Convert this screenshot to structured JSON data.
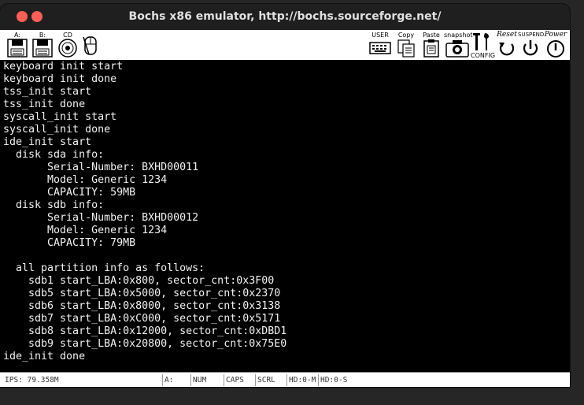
{
  "window": {
    "title": "Bochs x86 emulator, http://bochs.sourceforge.net/"
  },
  "toolbar": {
    "floppy_a": "A:",
    "floppy_b": "B:",
    "cdrom": "CD",
    "user": "USER",
    "copy": "Copy",
    "paste": "Paste",
    "snapshot": "snapshot",
    "config": "CONFIG",
    "reset": "Reset",
    "suspend": "SUSPEND",
    "power": "Power"
  },
  "console": {
    "lines": [
      "keyboard init start",
      "keyboard init done",
      "tss_init start",
      "tss_init done",
      "syscall_init start",
      "syscall_init done",
      "ide_init start",
      "  disk sda info:",
      "       Serial-Number: BXHD00011",
      "       Model: Generic 1234",
      "       CAPACITY: 59MB",
      "  disk sdb info:",
      "       Serial-Number: BXHD00012",
      "       Model: Generic 1234",
      "       CAPACITY: 79MB",
      "",
      "  all partition info as follows:",
      "    sdb1 start_LBA:0x800, sector_cnt:0x3F00",
      "    sdb5 start_LBA:0x5000, sector_cnt:0x2370",
      "    sdb6 start_LBA:0x8000, sector_cnt:0x3138",
      "    sdb7 start_LBA:0xC000, sector_cnt:0x5171",
      "    sdb8 start_LBA:0x12000, sector_cnt:0xDBD1",
      "    sdb9 start_LBA:0x20800, sector_cnt:0x75E0",
      "ide_init done"
    ]
  },
  "status": {
    "ips": "IPS: 79.358M",
    "a": "A:",
    "num": "NUM",
    "caps": "CAPS",
    "scrl": "SCRL",
    "hd0m": "HD:0-M",
    "hd0s": "HD:0-S"
  },
  "colors": {
    "titlebar_bg": "#1f1f1f",
    "close_button": "#ff5f57",
    "console_bg": "#000000",
    "console_text": "#f2f2f2"
  }
}
